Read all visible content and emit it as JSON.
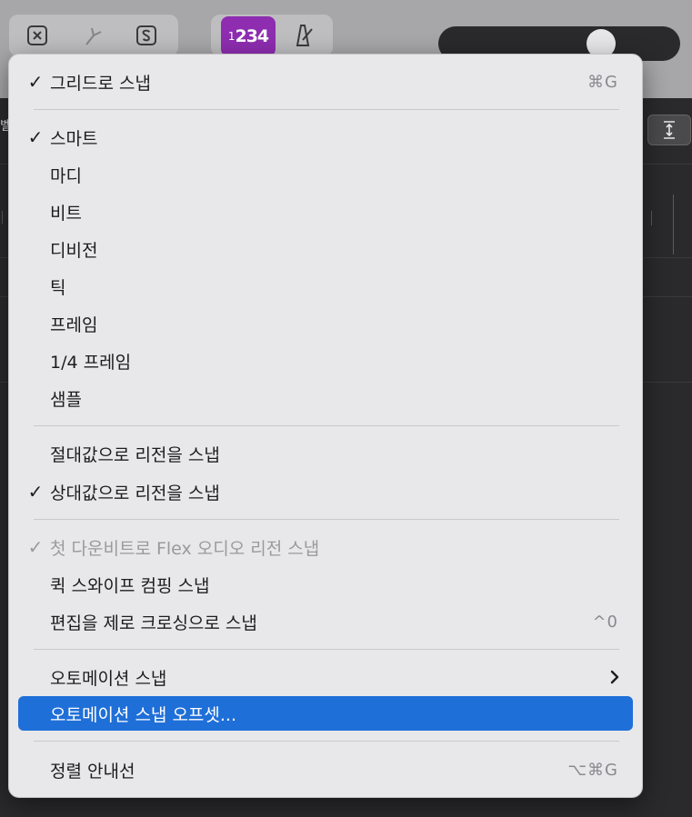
{
  "background": {
    "lcd_small": "1",
    "lcd_main": "234",
    "edge_text": "벨"
  },
  "menu": {
    "items": [
      {
        "label": "그리드로 스냅",
        "checked": true,
        "shortcut": "⌘G"
      },
      {
        "label": "스마트",
        "checked": true
      },
      {
        "label": "마디",
        "checked": false
      },
      {
        "label": "비트",
        "checked": false
      },
      {
        "label": "디비전",
        "checked": false
      },
      {
        "label": "틱",
        "checked": false
      },
      {
        "label": "프레임",
        "checked": false
      },
      {
        "label": "1/4 프레임",
        "checked": false
      },
      {
        "label": "샘플",
        "checked": false
      },
      {
        "label": "절대값으로 리전을 스냅",
        "checked": false
      },
      {
        "label": "상대값으로 리전을 스냅",
        "checked": true
      },
      {
        "label": "첫 다운비트로 Flex 오디오 리전 스냅",
        "checked": true,
        "disabled": true
      },
      {
        "label": "퀵 스와이프 컴핑 스냅",
        "checked": false
      },
      {
        "label": "편집을 제로 크로싱으로 스냅",
        "checked": false,
        "shortcut": "^0"
      },
      {
        "label": "오토메이션 스냅",
        "checked": false,
        "submenu": true
      },
      {
        "label": "오토메이션 스냅 오프셋...",
        "checked": false,
        "highlighted": true
      },
      {
        "label": "정렬 안내선",
        "checked": false,
        "shortcut": "⌥⌘G"
      }
    ],
    "check_glyph": "✓",
    "highlight_color": "#1f6fd8"
  }
}
